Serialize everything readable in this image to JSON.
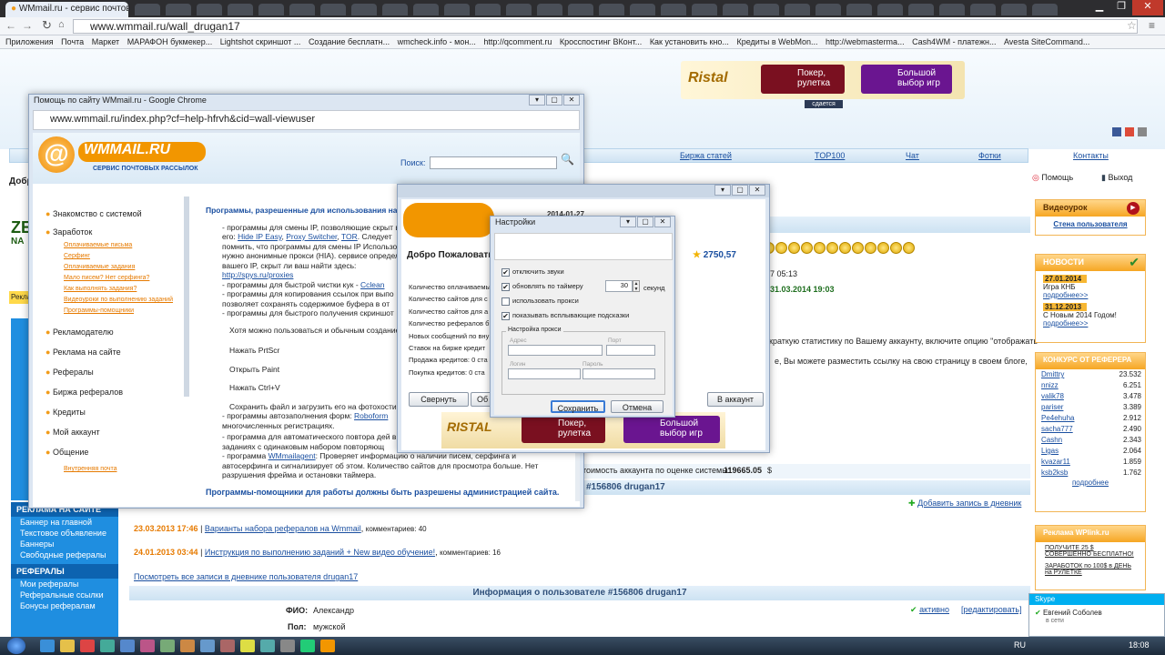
{
  "browser": {
    "tab_title": "WMmail.ru - сервис почтов",
    "url": "www.wmmail.ru/wall_drugan17",
    "bookmarks": [
      "Приложения",
      "Почта",
      "Маркет",
      "МАРАФОН букмекер...",
      "Lightshot скриншот ...",
      "Создание бесплатн...",
      "wmcheck.info - мон...",
      "http://qcomment.ru",
      "Кросспостинг ВКонт...",
      "Как установить кно...",
      "Кредиты в WebMon...",
      "http://webmasterma...",
      "Cash4WM - платежн...",
      "Avesta SiteCommand..."
    ]
  },
  "site": {
    "nav": [
      "Биржа статей",
      "TOP100",
      "Чат",
      "Фотки",
      "Контакты"
    ],
    "help_label": "Помощь",
    "exit_label": "Выход",
    "banner_leased": "сдается",
    "poker": "Покер, рулетка",
    "big_choice": "Большой выбор игр",
    "left_menu_head1": "РЕКЛАМА НА САЙТЕ",
    "left_menu_items1": [
      "Баннер на главной",
      "Текстовое объявление",
      "Баннеры",
      "Свободные рефералы"
    ],
    "left_menu_head2": "РЕФЕРАЛЫ",
    "left_menu_items2": [
      "Мои рефералы",
      "Реферальные ссылки",
      "Бонусы рефералам"
    ],
    "left_partial": [
      "Добр",
      "Рекла",
      "ZE",
      "NA"
    ],
    "balance": "2750,57",
    "date_line1": "7 05:13",
    "date_line2": "31.03.2014 19:03",
    "stat_text1": "краткую статистику по Вашему аккаунту, включите опцию \"отображать",
    "stat_text2": "е, Вы можете разместить ссылку на свою страницу в своем блоге,",
    "value_label": "тоимость аккаунта по оценке системы:",
    "value_amount": "119665.05",
    "value_currency": "$",
    "diary_head": "#156806 drugan17",
    "add_diary": "Добавить запись в дневник",
    "posts": [
      {
        "date": "23.03.2013 17:46",
        "title": "Варианты набора рефералов на Wmmail",
        "comments": "комментариев: 40"
      },
      {
        "date": "24.01.2013 03:44",
        "title": "Инструкция по выполнению заданий + New видео обучение!",
        "comments": "комментариев: 16"
      }
    ],
    "all_posts": "Посмотреть все записи в дневнике пользователя drugan17",
    "user_info_head": "Информация о пользователе #156806 drugan17",
    "fio_label": "ФИО:",
    "fio_value": "Александр",
    "sex_label": "Пол:",
    "sex_value": "мужской",
    "active": "активно",
    "edit": "[редактировать]"
  },
  "right": {
    "video_head": "Видеоурок",
    "video_link": "Стена пользователя",
    "news_head": "НОВОСТИ",
    "news": [
      {
        "date": "27.01.2014",
        "text": "Игра КНБ",
        "more": "подробнее>>"
      },
      {
        "date": "31.12.2013",
        "text": "С Новым 2014 Годом!",
        "more": "подробнее>>"
      }
    ],
    "ref_head": "КОНКУРС ОТ РЕФЕРЕРА",
    "refs": [
      [
        "Dmittry",
        "23.532"
      ],
      [
        "nnizz",
        "6.251"
      ],
      [
        "valik78",
        "3.478"
      ],
      [
        "pariser",
        "3.389"
      ],
      [
        "Pe4ehuha",
        "2.912"
      ],
      [
        "sacha777",
        "2.490"
      ],
      [
        "Cashn",
        "2.343"
      ],
      [
        "Ligas",
        "2.064"
      ],
      [
        "kvazar11",
        "1.859"
      ],
      [
        "ksb2ksb",
        "1.762"
      ]
    ],
    "ref_more": "подробнее",
    "wpl_head": "Реклама WPlink.ru",
    "wpl_items": [
      "ПОЛУЧИТЕ 25 $ СОВЕРШЕННО БЕСПЛАТНО!",
      "ЗАРАБОТОК по 100$ в ДЕНЬ на РУЛЕТКЕ"
    ]
  },
  "help_window": {
    "title": "Помощь по сайту WMmail.ru - Google Chrome",
    "url": "www.wmmail.ru/index.php?cf=help-hfrvh&cid=wall-viewuser",
    "logo": "WMMAIL.RU",
    "logo_sub": "СЕРВИС ПОЧТОВЫХ РАССЫЛОК",
    "search_label": "Поиск:",
    "menu": [
      "Знакомство с системой",
      "Заработок",
      "Рекламодателю",
      "Реклама на сайте",
      "Рефералы",
      "Биржа рефералов",
      "Кредиты",
      "Мой аккаунт",
      "Общение"
    ],
    "submenu": [
      "Оплачиваемые письма",
      "Серфинг",
      "Оплачиваемые задания",
      "Мало писем? Нет серфинга?",
      "Как выполнять задания?",
      "Видеоуроки по выполнению заданий",
      "Программы-помощники"
    ],
    "submenu_last": "Внутренняя почта",
    "heading": "Программы, разрешенные для использования на",
    "p1": "- программы для смены IP, позволяющие скрыт вернуть его:",
    "p1_links": [
      "Hide IP Easy",
      "Proxy Switcher",
      "TOR"
    ],
    "p1b": "Следует помнить, что программы для смены IP Использовать нужно анонимные прокси (HIA). сервисе определения вашего IP, скрыт ли ваш найти здесь:",
    "p1_link2": "http://spys.ru/proxies",
    "p2": "- программы для быстрой чистки кук -",
    "p2_link": "Cclean",
    "p3": "- программы для копирования ссылок при выпо позволяет сохранять содержимое буфера в от",
    "p4": "- программы для быстрого получения скриншот",
    "p5": "Хотя можно пользоваться и обычным создание",
    "k1": "Нажать PrtScr",
    "k2": "Открыть Paint",
    "k3": "Нажать Ctrl+V",
    "p6": "Сохранить файл и загрузить его на фотохостин",
    "p7": "- программы автозаполнения форм:",
    "p7_link": "Roboform",
    "p7b": "многочисленных регистрациях.",
    "p8": "- программа для автоматического повтора дей в заданиях с одинаковым набором повторяющ",
    "p9": "- программа",
    "p9_link": "WMmailagent",
    "p9b": ": Проверяет информацию о наличии писем, серфинга и автосерфинга и сигнализирует об этом. Количество сайтов для просмотра больше. Нет разрушения фрейма и остановки таймера.",
    "footer": "Программы-помощники для работы должны быть разрешены администрацией сайта."
  },
  "agent_window": {
    "date": "2014-01-27",
    "welcome": "Добро Пожаловать",
    "rows": [
      "Количество оплачиваемы",
      "Количество сайтов для с",
      "Количество сайтов для а",
      "Количество рефералов б",
      "Новых сообщений по вну",
      "Ставок на бирже кредит",
      "Продажа кредитов: 0 ста",
      "Покупка кредитов: 0 ста"
    ],
    "collapse": "Свернуть",
    "other": "Об",
    "account": "В аккаунт"
  },
  "settings_window": {
    "title": "Настройки",
    "opt_sound": "отключить звуки",
    "opt_timer": "обновлять по таймеру",
    "timer_value": "30",
    "timer_unit": "секунд",
    "opt_proxy": "использовать прокси",
    "opt_hints": "показывать всплывающие подсказки",
    "proxy_group": "Настройка прокси",
    "addr": "Адрес",
    "port": "Порт",
    "login": "Логин",
    "password": "Пароль",
    "save": "Сохранить",
    "cancel": "Отмена"
  },
  "taskbar": {
    "lang": "RU",
    "time": "18:08"
  },
  "skype": {
    "head": "Skype",
    "name": "Евгений Соболев",
    "status": "в сети"
  }
}
